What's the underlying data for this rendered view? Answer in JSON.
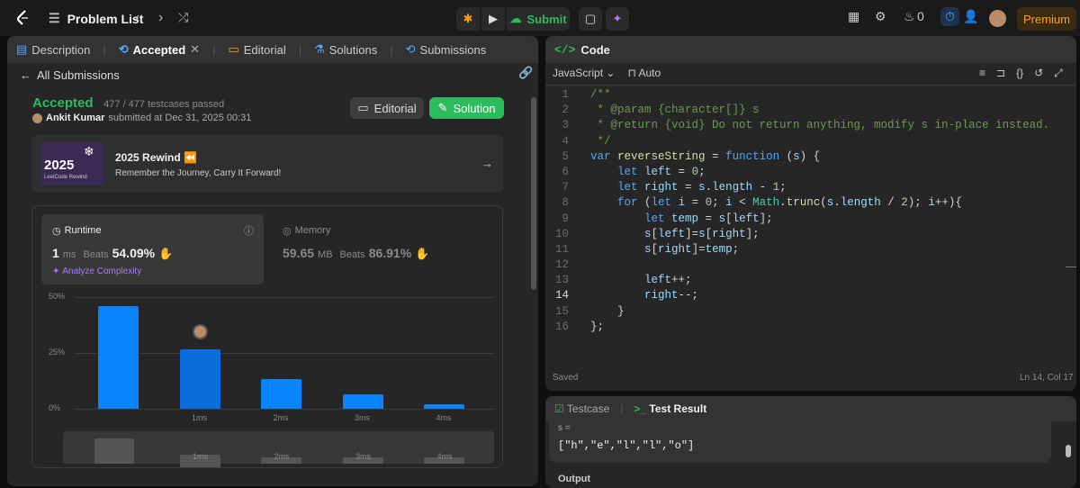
{
  "topbar": {
    "problem_list": "Problem List",
    "submit": "Submit",
    "streak": "0",
    "premium": "Premium"
  },
  "left": {
    "tabs": [
      "Description",
      "Accepted",
      "Editorial",
      "Solutions",
      "Submissions"
    ],
    "back": "All Submissions",
    "status": "Accepted",
    "testcases": "477 / 477 testcases passed",
    "user": "Ankit Kumar",
    "submitted": "submitted at Dec 31, 2025 00:31",
    "editorial_btn": "Editorial",
    "solution_btn": "Solution",
    "rewind": {
      "badge_year": "2025",
      "badge_sub": "LeetCode Rewind",
      "title": "2025 Rewind",
      "subtitle": "Remember the Journey, Carry It Forward!"
    },
    "runtime": {
      "label": "Runtime",
      "value": "1",
      "unit": "ms",
      "beats_label": "Beats",
      "beats": "54.09%",
      "analyze": "Analyze Complexity"
    },
    "memory": {
      "label": "Memory",
      "value": "59.65",
      "unit": "MB",
      "beats_label": "Beats",
      "beats": "86.91%"
    }
  },
  "chart_data": {
    "type": "bar",
    "yticks": [
      "50%",
      "25%",
      "0%"
    ],
    "categories": [
      "",
      "1ms",
      "2ms",
      "3ms",
      "4ms"
    ],
    "values": [
      46,
      26.5,
      13.5,
      6.5,
      2.2
    ],
    "ylim": [
      0,
      50
    ],
    "highlight_index": 1,
    "mini_labels": [
      "1ms",
      "2ms",
      "3ms",
      "4ms"
    ]
  },
  "code": {
    "title": "Code",
    "language": "JavaScript",
    "mode": "Auto",
    "saved": "Saved",
    "cursor": "Ln 14, Col 17",
    "lines": [
      [
        [
          "cm",
          "/**"
        ]
      ],
      [
        [
          "cm",
          " * @param {character[]} s"
        ]
      ],
      [
        [
          "cm",
          " * @return {void} Do not return anything, modify s in-place instead."
        ]
      ],
      [
        [
          "cm",
          " */"
        ]
      ],
      [
        [
          "kw",
          "var "
        ],
        [
          "fn",
          "reverseString"
        ],
        [
          "tx",
          " = "
        ],
        [
          "kw",
          "function"
        ],
        [
          "tx",
          " ("
        ],
        [
          "vr",
          "s"
        ],
        [
          "tx",
          ") {"
        ]
      ],
      [
        [
          "tx",
          "    "
        ],
        [
          "kw",
          "let "
        ],
        [
          "vr",
          "left"
        ],
        [
          "tx",
          " = "
        ],
        [
          "nm",
          "0"
        ],
        [
          "tx",
          ";"
        ]
      ],
      [
        [
          "tx",
          "    "
        ],
        [
          "kw",
          "let "
        ],
        [
          "vr",
          "right"
        ],
        [
          "tx",
          " = "
        ],
        [
          "vr",
          "s"
        ],
        [
          "tx",
          "."
        ],
        [
          "vr",
          "length"
        ],
        [
          "tx",
          " - "
        ],
        [
          "nm",
          "1"
        ],
        [
          "tx",
          ";"
        ]
      ],
      [
        [
          "tx",
          "    "
        ],
        [
          "kw",
          "for"
        ],
        [
          "tx",
          " ("
        ],
        [
          "kw",
          "let "
        ],
        [
          "vr",
          "i"
        ],
        [
          "tx",
          " = "
        ],
        [
          "nm",
          "0"
        ],
        [
          "tx",
          "; "
        ],
        [
          "vr",
          "i"
        ],
        [
          "tx",
          " < "
        ],
        [
          "cy",
          "Math"
        ],
        [
          "tx",
          "."
        ],
        [
          "fn",
          "trunc"
        ],
        [
          "tx",
          "("
        ],
        [
          "vr",
          "s"
        ],
        [
          "tx",
          "."
        ],
        [
          "vr",
          "length"
        ],
        [
          "tx",
          " / "
        ],
        [
          "nm",
          "2"
        ],
        [
          "tx",
          "); "
        ],
        [
          "vr",
          "i"
        ],
        [
          "tx",
          "++){"
        ]
      ],
      [
        [
          "tx",
          "        "
        ],
        [
          "kw",
          "let "
        ],
        [
          "vr",
          "temp"
        ],
        [
          "tx",
          " = "
        ],
        [
          "vr",
          "s"
        ],
        [
          "tx",
          "["
        ],
        [
          "vr",
          "left"
        ],
        [
          "tx",
          "];"
        ]
      ],
      [
        [
          "tx",
          "        "
        ],
        [
          "vr",
          "s"
        ],
        [
          "tx",
          "["
        ],
        [
          "vr",
          "left"
        ],
        [
          "tx",
          "]="
        ],
        [
          "vr",
          "s"
        ],
        [
          "tx",
          "["
        ],
        [
          "vr",
          "right"
        ],
        [
          "tx",
          "];"
        ]
      ],
      [
        [
          "tx",
          "        "
        ],
        [
          "vr",
          "s"
        ],
        [
          "tx",
          "["
        ],
        [
          "vr",
          "right"
        ],
        [
          "tx",
          "]="
        ],
        [
          "vr",
          "temp"
        ],
        [
          "tx",
          ";"
        ]
      ],
      [
        [
          "tx",
          ""
        ]
      ],
      [
        [
          "tx",
          "        "
        ],
        [
          "vr",
          "left"
        ],
        [
          "tx",
          "++;"
        ]
      ],
      [
        [
          "tx",
          "        "
        ],
        [
          "vr",
          "right"
        ],
        [
          "tx",
          "--;"
        ]
      ],
      [
        [
          "tx",
          "    }"
        ]
      ],
      [
        [
          "tx",
          "};"
        ]
      ]
    ]
  },
  "result": {
    "tab1": "Testcase",
    "tab2": "Test Result",
    "var_label": "s =",
    "input": "[\"h\",\"e\",\"l\",\"l\",\"o\"]",
    "output_label": "Output"
  }
}
